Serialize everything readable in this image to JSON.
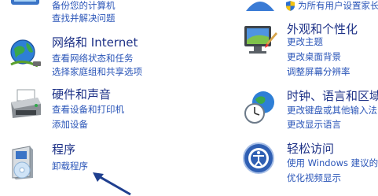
{
  "left_column": [
    {
      "id": "system",
      "title": "",
      "links": [
        "备份您的计算机",
        "查找并解决问题"
      ],
      "icon": "system-security-icon"
    },
    {
      "id": "network",
      "title": "网络和 Internet",
      "links": [
        "查看网络状态和任务",
        "选择家庭组和共享选项"
      ],
      "icon": "network-globe-icon"
    },
    {
      "id": "hardware",
      "title": "硬件和声音",
      "links": [
        "查看设备和打印机",
        "添加设备"
      ],
      "icon": "printer-icon"
    },
    {
      "id": "programs",
      "title": "程序",
      "links": [
        "卸载程序"
      ],
      "icon": "programs-disc-icon"
    }
  ],
  "right_column": [
    {
      "id": "accounts",
      "title": "",
      "links": [
        "为所有用户设置家长"
      ],
      "icon": "user-accounts-icon"
    },
    {
      "id": "appearance",
      "title": "外观和个性化",
      "links": [
        "更改主题",
        "更改桌面背景",
        "调整屏幕分辨率"
      ],
      "icon": "monitor-icon"
    },
    {
      "id": "clock",
      "title": "时钟、语言和区域",
      "links": [
        "更改键盘或其他输入法",
        "更改显示语言"
      ],
      "icon": "clock-globe-icon"
    },
    {
      "id": "ease",
      "title": "轻松访问",
      "links": [
        "使用 Windows 建议的设置",
        "优化视频显示"
      ],
      "icon": "ease-of-access-icon"
    }
  ],
  "colors": {
    "title": "#1e3287",
    "link": "#2a55b8",
    "arrow": "#1f3f8f"
  }
}
